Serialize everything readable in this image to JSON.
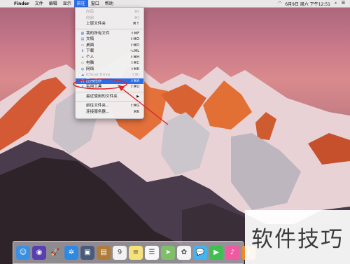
{
  "menubar": {
    "apple_icon": "apple-logo",
    "app_name": "Finder",
    "menus": [
      "文件",
      "编辑",
      "显示",
      "前往",
      "窗口",
      "帮助"
    ],
    "active_menu": "前往",
    "status": {
      "wifi_icon": "wifi-icon",
      "clock": "6月9日 周六 下午12:51",
      "search_icon": "spotlight-search-icon",
      "list_icon": "notification-center-icon"
    }
  },
  "go_menu": {
    "items": [
      {
        "label": "向后",
        "shortcut": "⌘[",
        "icon": "",
        "state": "disabled"
      },
      {
        "label": "向前",
        "shortcut": "⌘]",
        "icon": "",
        "state": "disabled"
      },
      {
        "label": "上层文件夹",
        "shortcut": "⌘↑",
        "icon": "",
        "state": "normal"
      },
      {
        "label": "我的所有文件",
        "shortcut": "⇧⌘F",
        "icon": "all-my-files-icon",
        "state": "normal"
      },
      {
        "label": "文稿",
        "shortcut": "⇧⌘O",
        "icon": "documents-icon",
        "state": "normal"
      },
      {
        "label": "桌面",
        "shortcut": "⇧⌘D",
        "icon": "desktop-icon",
        "state": "normal"
      },
      {
        "label": "下载",
        "shortcut": "⌥⌘L",
        "icon": "downloads-icon",
        "state": "normal"
      },
      {
        "label": "个人",
        "shortcut": "⇧⌘H",
        "icon": "home-icon",
        "state": "normal"
      },
      {
        "label": "电脑",
        "shortcut": "⇧⌘C",
        "icon": "computer-icon",
        "state": "normal"
      },
      {
        "label": "网络",
        "shortcut": "⇧⌘K",
        "icon": "network-icon",
        "state": "normal"
      },
      {
        "label": "iCloud Drive",
        "shortcut": "⇧⌘I",
        "icon": "icloud-icon",
        "state": "disabled"
      },
      {
        "label": "应用程序",
        "shortcut": "⇧⌘A",
        "icon": "applications-icon",
        "state": "highlighted"
      },
      {
        "label": "实用工具",
        "shortcut": "⇧⌘U",
        "icon": "utilities-icon",
        "state": "normal"
      },
      {
        "label": "最近使用的文件夹",
        "shortcut": "▶",
        "icon": "",
        "state": "normal"
      },
      {
        "label": "前往文件夹...",
        "shortcut": "⇧⌘G",
        "icon": "",
        "state": "normal"
      },
      {
        "label": "连接服务器...",
        "shortcut": "⌘K",
        "icon": "",
        "state": "normal"
      }
    ]
  },
  "dock": {
    "apps": [
      {
        "name": "finder",
        "color": "#3b8fe0",
        "glyph": "☺"
      },
      {
        "name": "siri",
        "color": "#5a3fb0",
        "glyph": "◉"
      },
      {
        "name": "launchpad",
        "color": "#8c8c8c",
        "glyph": "🚀"
      },
      {
        "name": "safari",
        "color": "#2f89e3",
        "glyph": "✲"
      },
      {
        "name": "photo-booth",
        "color": "#4a5a7a",
        "glyph": "▣"
      },
      {
        "name": "notes-book",
        "color": "#b07c3a",
        "glyph": "▤"
      },
      {
        "name": "calendar",
        "color": "#f2f2f2",
        "glyph": "9"
      },
      {
        "name": "notes",
        "color": "#f5e27a",
        "glyph": "≡"
      },
      {
        "name": "reminders",
        "color": "#f7f7f7",
        "glyph": "☰"
      },
      {
        "name": "maps",
        "color": "#7fbf6a",
        "glyph": "➤"
      },
      {
        "name": "photos",
        "color": "#f4f4f4",
        "glyph": "✿"
      },
      {
        "name": "messages",
        "color": "#43b4f0",
        "glyph": "💬"
      },
      {
        "name": "facetime",
        "color": "#3fbf4f",
        "glyph": "▶"
      },
      {
        "name": "itunes",
        "color": "#f05aa0",
        "glyph": "♪"
      },
      {
        "name": "ibooks",
        "color": "#f08a2a",
        "glyph": "▮"
      }
    ]
  },
  "watermark": {
    "text": "软件技巧"
  }
}
